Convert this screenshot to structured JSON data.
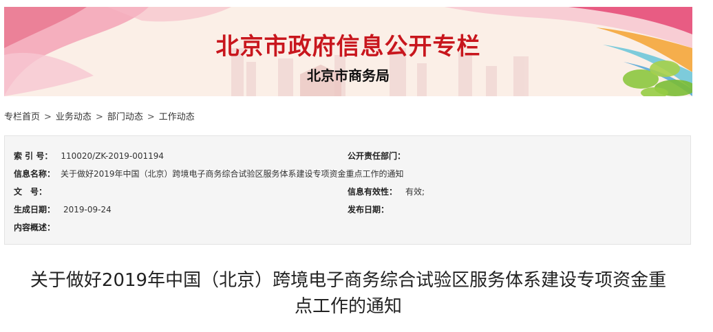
{
  "banner": {
    "title": "北京市政府信息公开专栏",
    "subtitle": "北京市商务局"
  },
  "breadcrumb": {
    "items": [
      "专栏首页",
      "业务动态",
      "部门动态",
      "工作动态"
    ],
    "separator": ">"
  },
  "info": {
    "index_label": "索 引 号：",
    "index_value": "110020/ZK-2019-001194",
    "dept_label": "公开责任部门：",
    "dept_value": "",
    "name_label": "信息名称：",
    "name_value": "关于做好2019年中国（北京）跨境电子商务综合试验区服务体系建设专项资金重点工作的通知",
    "doc_label": "文　号：",
    "doc_value": "",
    "validity_label": "信息有效性：",
    "validity_value": "有效;",
    "created_label": "生成日期：",
    "created_value": "2019-09-24",
    "published_label": "发布日期：",
    "published_value": "",
    "summary_label": "内容概述：",
    "summary_value": ""
  },
  "article": {
    "title_line1": "关于做好2019年中国（北京）跨境电子商务综合试验区服务体系建设专项资金重",
    "title_line2": "点工作的通知"
  },
  "colors": {
    "banner_title": "#c8161d",
    "banner_bg": "#fbefe7",
    "infobox_bg": "#f5f5f5",
    "infobox_border": "#e3e3e3"
  }
}
